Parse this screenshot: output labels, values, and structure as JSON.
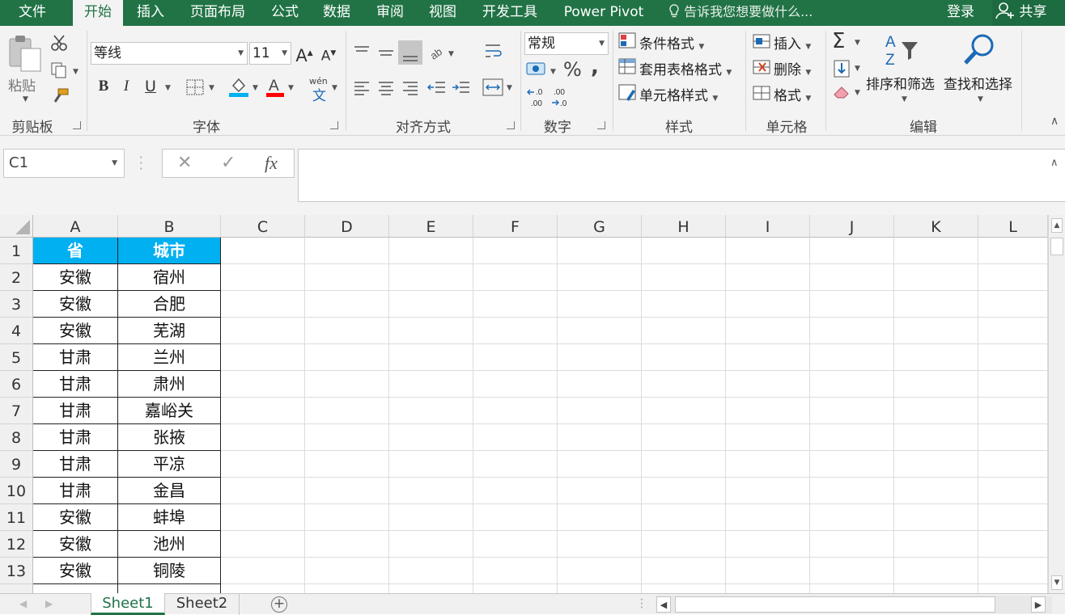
{
  "menu": {
    "tabs": [
      "文件",
      "开始",
      "插入",
      "页面布局",
      "公式",
      "数据",
      "审阅",
      "视图",
      "开发工具",
      "Power Pivot"
    ],
    "active_tab": "开始",
    "tell_me": "告诉我您想要做什么...",
    "login": "登录",
    "share": "共享"
  },
  "ribbon": {
    "clipboard": {
      "label": "剪贴板",
      "paste": "粘贴"
    },
    "font": {
      "label": "字体",
      "font_name": "等线",
      "font_size": "11",
      "bold": "B",
      "italic": "I",
      "underline": "U",
      "phonetic": "wén"
    },
    "alignment": {
      "label": "对齐方式"
    },
    "number": {
      "label": "数字",
      "format": "常规",
      "percent": "%",
      "comma": ","
    },
    "styles": {
      "label": "样式",
      "conditional": "条件格式",
      "table_format": "套用表格格式",
      "cell_style": "单元格样式"
    },
    "cells": {
      "label": "单元格",
      "insert": "插入",
      "delete": "删除",
      "format": "格式"
    },
    "editing": {
      "label": "编辑",
      "sort_filter": "排序和筛选",
      "find_select": "查找和选择"
    }
  },
  "formula_bar": {
    "name_box": "C1",
    "cancel": "✕",
    "enter": "✓",
    "fx": "fx",
    "value": ""
  },
  "sheet": {
    "columns": [
      "A",
      "B",
      "C",
      "D",
      "E",
      "F",
      "G",
      "H",
      "I",
      "J",
      "K",
      "L"
    ],
    "rows": [
      "1",
      "2",
      "3",
      "4",
      "5",
      "6",
      "7",
      "8",
      "9",
      "10",
      "11",
      "12",
      "13"
    ],
    "header": [
      "省",
      "城市"
    ],
    "data": [
      [
        "安徽",
        "宿州"
      ],
      [
        "安徽",
        "合肥"
      ],
      [
        "安徽",
        "芜湖"
      ],
      [
        "甘肃",
        "兰州"
      ],
      [
        "甘肃",
        "肃州"
      ],
      [
        "甘肃",
        "嘉峪关"
      ],
      [
        "甘肃",
        "张掖"
      ],
      [
        "甘肃",
        "平凉"
      ],
      [
        "甘肃",
        "金昌"
      ],
      [
        "安徽",
        "蚌埠"
      ],
      [
        "安徽",
        "池州"
      ],
      [
        "安徽",
        "铜陵"
      ]
    ],
    "header_color": "#00B0F0"
  },
  "sheet_tabs": [
    "Sheet1",
    "Sheet2"
  ],
  "active_sheet": "Sheet1",
  "theme": {
    "accent": "#217346"
  }
}
